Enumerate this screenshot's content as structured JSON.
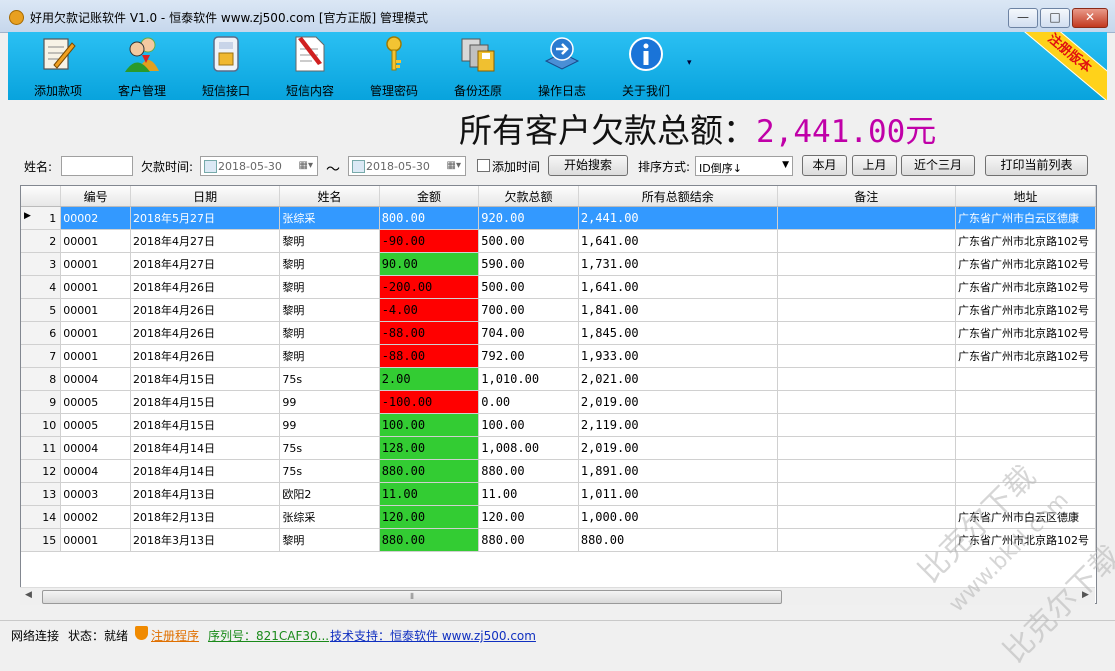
{
  "window": {
    "title": "好用欠款记账软件 V1.0 - 恒泰软件   www.zj500.com [官方正版]   管理模式",
    "minimize": "—",
    "maximize": "□",
    "close": "✕"
  },
  "toolbar": {
    "items": [
      {
        "label": "添加款项",
        "icon": "notepad-pencil-icon"
      },
      {
        "label": "客户管理",
        "icon": "users-icon"
      },
      {
        "label": "短信接口",
        "icon": "sim-card-icon"
      },
      {
        "label": "短信内容",
        "icon": "document-pencil-icon"
      },
      {
        "label": "管理密码",
        "icon": "key-icon"
      },
      {
        "label": "备份还原",
        "icon": "backup-disks-icon"
      },
      {
        "label": "操作日志",
        "icon": "log-arrow-icon"
      },
      {
        "label": "关于我们",
        "icon": "info-icon"
      }
    ],
    "more": "▾",
    "ribbon": "注册版本"
  },
  "summary": {
    "label": "所有客户欠款总额：",
    "amount": "2,441.00元"
  },
  "filter": {
    "name_label": "姓名:",
    "name_value": "",
    "time_label": "欠款时间:",
    "date_from": "2018-05-30",
    "tilde": "～",
    "date_to": "2018-05-30",
    "add_time_label": "添加时间",
    "search_button": "开始搜索",
    "sort_label": "排序方式:",
    "sort_value": "ID倒序↓",
    "this_month": "本月",
    "last_month": "上月",
    "last_three_months": "近个三月",
    "print_button": "打印当前列表"
  },
  "table": {
    "columns": [
      "编号",
      "日期",
      "姓名",
      "金额",
      "欠款总额",
      "所有总额结余",
      "备注",
      "地址"
    ],
    "rows": [
      {
        "n": "1",
        "id": "00002",
        "date": "2018年5月27日",
        "name": "张综采",
        "amount": "800.00",
        "debt": "920.00",
        "balance": "2,441.00",
        "note": "",
        "address": "广东省广州市白云区德康",
        "status": "none"
      },
      {
        "n": "2",
        "id": "00001",
        "date": "2018年4月27日",
        "name": "黎明",
        "amount": "-90.00",
        "debt": "500.00",
        "balance": "1,641.00",
        "note": "",
        "address": "广东省广州市北京路102号",
        "status": "neg"
      },
      {
        "n": "3",
        "id": "00001",
        "date": "2018年4月27日",
        "name": "黎明",
        "amount": "90.00",
        "debt": "590.00",
        "balance": "1,731.00",
        "note": "",
        "address": "广东省广州市北京路102号",
        "status": "pos"
      },
      {
        "n": "4",
        "id": "00001",
        "date": "2018年4月26日",
        "name": "黎明",
        "amount": "-200.00",
        "debt": "500.00",
        "balance": "1,641.00",
        "note": "",
        "address": "广东省广州市北京路102号",
        "status": "neg"
      },
      {
        "n": "5",
        "id": "00001",
        "date": "2018年4月26日",
        "name": "黎明",
        "amount": "-4.00",
        "debt": "700.00",
        "balance": "1,841.00",
        "note": "",
        "address": "广东省广州市北京路102号",
        "status": "neg"
      },
      {
        "n": "6",
        "id": "00001",
        "date": "2018年4月26日",
        "name": "黎明",
        "amount": "-88.00",
        "debt": "704.00",
        "balance": "1,845.00",
        "note": "",
        "address": "广东省广州市北京路102号",
        "status": "neg"
      },
      {
        "n": "7",
        "id": "00001",
        "date": "2018年4月26日",
        "name": "黎明",
        "amount": "-88.00",
        "debt": "792.00",
        "balance": "1,933.00",
        "note": "",
        "address": "广东省广州市北京路102号",
        "status": "neg"
      },
      {
        "n": "8",
        "id": "00004",
        "date": "2018年4月15日",
        "name": "75s",
        "amount": "2.00",
        "debt": "1,010.00",
        "balance": "2,021.00",
        "note": "",
        "address": "",
        "status": "pos"
      },
      {
        "n": "9",
        "id": "00005",
        "date": "2018年4月15日",
        "name": "99",
        "amount": "-100.00",
        "debt": "0.00",
        "balance": "2,019.00",
        "note": "",
        "address": "",
        "status": "neg"
      },
      {
        "n": "10",
        "id": "00005",
        "date": "2018年4月15日",
        "name": "99",
        "amount": "100.00",
        "debt": "100.00",
        "balance": "2,119.00",
        "note": "",
        "address": "",
        "status": "pos"
      },
      {
        "n": "11",
        "id": "00004",
        "date": "2018年4月14日",
        "name": "75s",
        "amount": "128.00",
        "debt": "1,008.00",
        "balance": "2,019.00",
        "note": "",
        "address": "",
        "status": "pos"
      },
      {
        "n": "12",
        "id": "00004",
        "date": "2018年4月14日",
        "name": "75s",
        "amount": "880.00",
        "debt": "880.00",
        "balance": "1,891.00",
        "note": "",
        "address": "",
        "status": "pos"
      },
      {
        "n": "13",
        "id": "00003",
        "date": "2018年4月13日",
        "name": "欧阳2",
        "amount": "11.00",
        "debt": "11.00",
        "balance": "1,011.00",
        "note": "",
        "address": "",
        "status": "pos"
      },
      {
        "n": "14",
        "id": "00002",
        "date": "2018年2月13日",
        "name": "张综采",
        "amount": "120.00",
        "debt": "120.00",
        "balance": "1,000.00",
        "note": "",
        "address": "广东省广州市白云区德康",
        "status": "pos"
      },
      {
        "n": "15",
        "id": "00001",
        "date": "2018年3月13日",
        "name": "黎明",
        "amount": "880.00",
        "debt": "880.00",
        "balance": "880.00",
        "note": "",
        "address": "广东省广州市北京路102号",
        "status": "pos"
      }
    ],
    "selected_row": "1",
    "current_row_marker": "▶",
    "scroll_left": "◀",
    "scroll_right": "▶",
    "scroll_thumb": "⦀"
  },
  "statusbar": {
    "network": "网络连接",
    "state": "状态：就绪",
    "register": "注册程序",
    "serial": "序列号：821CAF30...",
    "support": "技术支持：恒泰软件  www.zj500.com"
  },
  "watermark": {
    "text1": "比克尔下载",
    "text2": "www.bkill.com"
  },
  "colors": {
    "toolbar": "#14b1e9",
    "selected_row": "#3399ff",
    "negative": "#ff0000",
    "positive": "#33cc33",
    "amount": "#c000a8"
  }
}
